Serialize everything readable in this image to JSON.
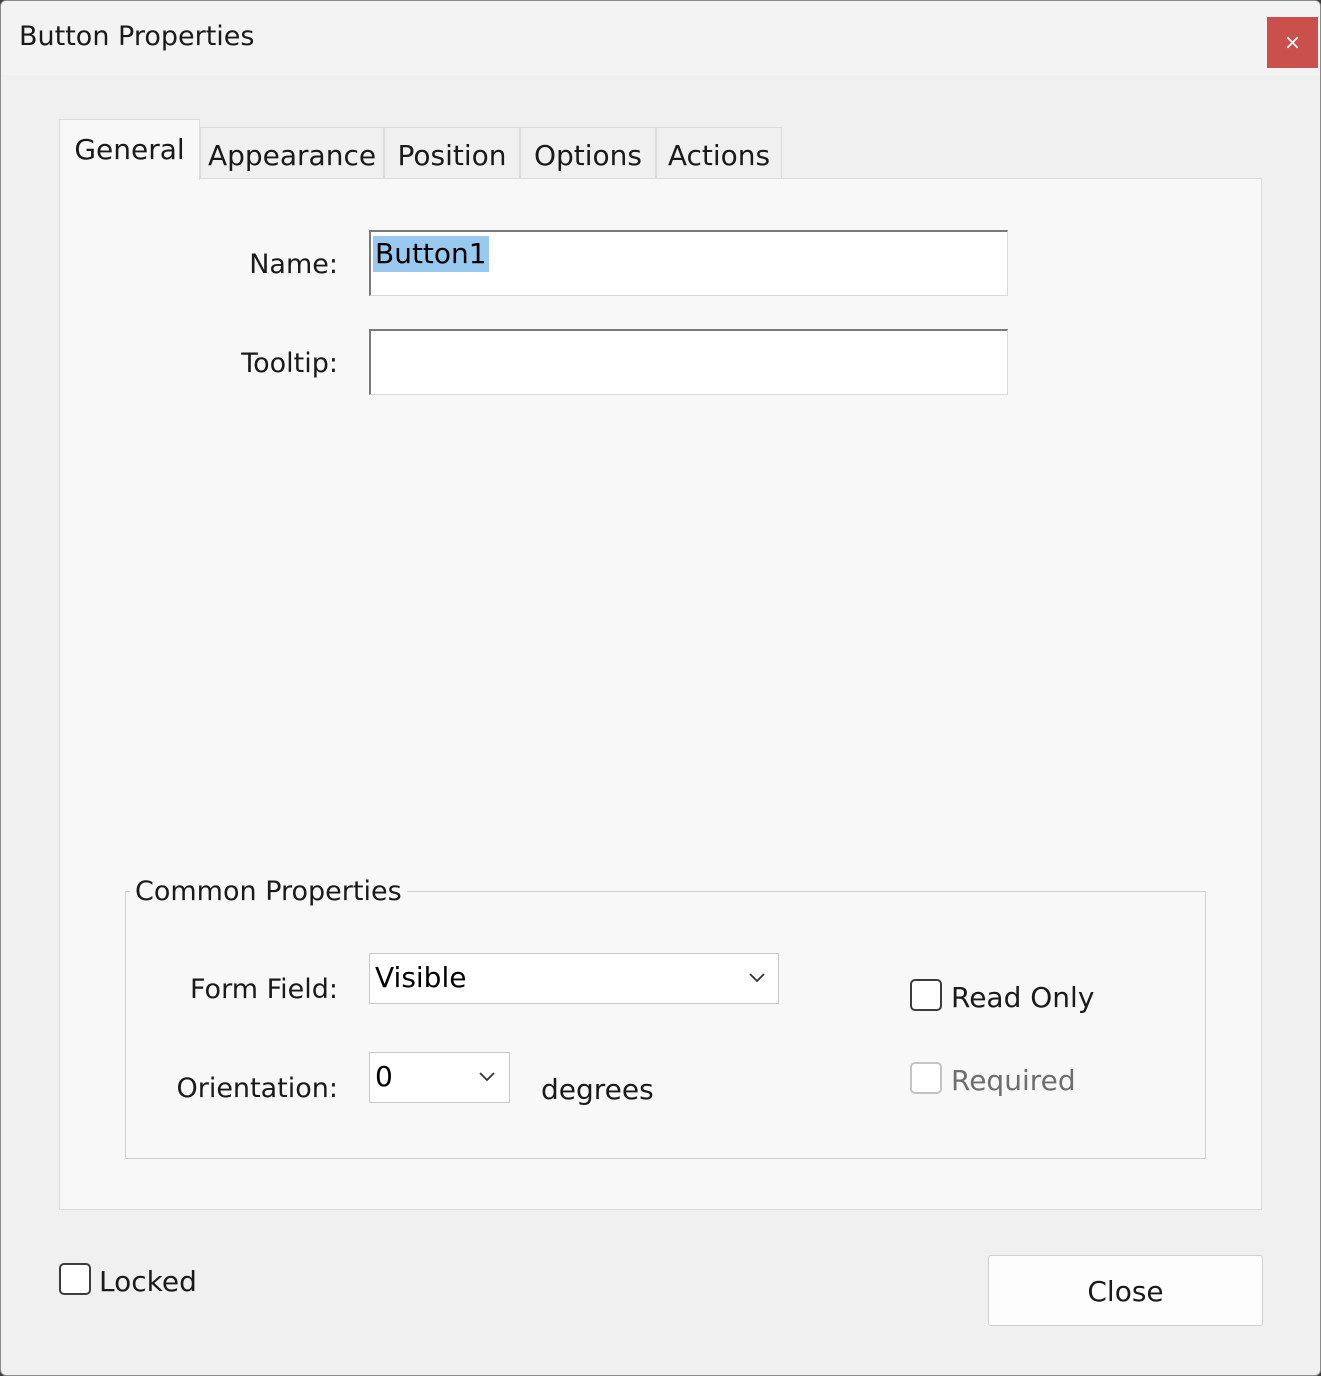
{
  "window": {
    "title": "Button Properties",
    "close_glyph": "×"
  },
  "tabs": [
    {
      "label": "General",
      "active": true
    },
    {
      "label": "Appearance",
      "active": false
    },
    {
      "label": "Position",
      "active": false
    },
    {
      "label": "Options",
      "active": false
    },
    {
      "label": "Actions",
      "active": false
    }
  ],
  "general": {
    "name_label": "Name:",
    "name_value": "Button1",
    "tooltip_label": "Tooltip:",
    "tooltip_value": ""
  },
  "common": {
    "legend": "Common Properties",
    "form_field_label": "Form Field:",
    "form_field_value": "Visible",
    "orientation_label": "Orientation:",
    "orientation_value": "0",
    "degrees_label": "degrees",
    "read_only_label": "Read Only",
    "read_only_checked": false,
    "required_label": "Required",
    "required_checked": false,
    "required_disabled": true
  },
  "footer": {
    "locked_label": "Locked",
    "locked_checked": false,
    "close_label": "Close"
  },
  "colors": {
    "close_button_bg": "#c9504b",
    "selection_highlight": "#99c9ef"
  }
}
